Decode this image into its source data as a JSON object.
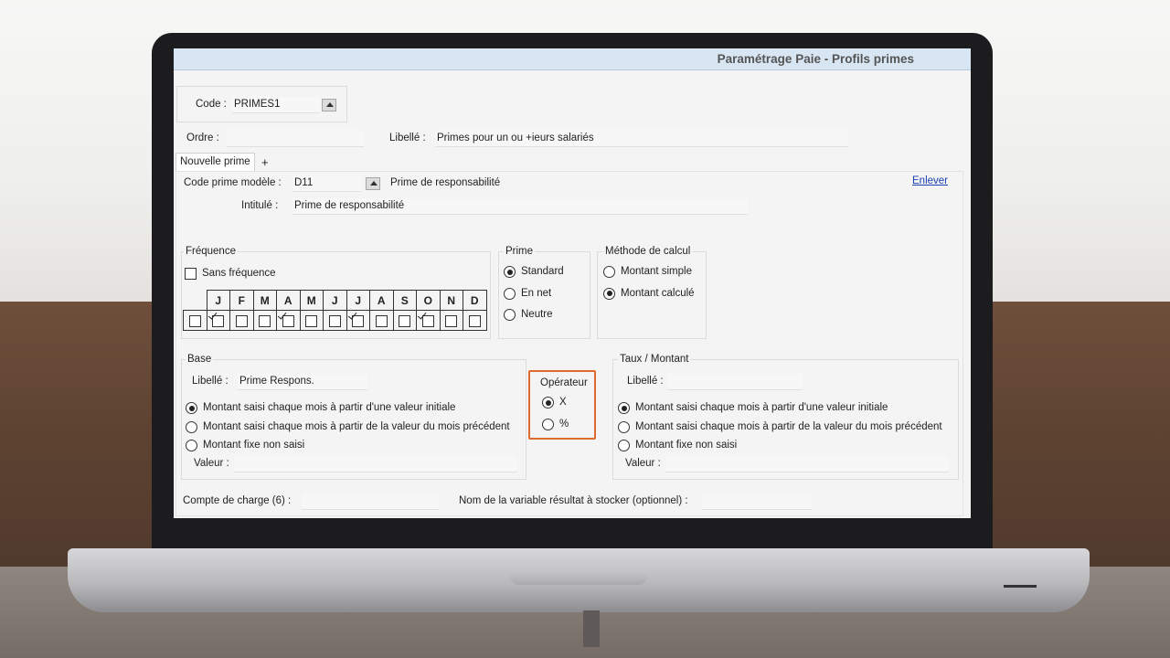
{
  "window": {
    "title": "Paramétrage Paie - Profils primes"
  },
  "header": {
    "code_label": "Code :",
    "code_value": "PRIMES1",
    "ordre_label": "Ordre :",
    "ordre_value": "",
    "libelle_label": "Libellé :",
    "libelle_value": "Primes pour un ou +ieurs salariés"
  },
  "tabs": [
    {
      "label": "Nouvelle prime"
    },
    {
      "label": "+"
    }
  ],
  "prime": {
    "code_label": "Code prime modèle :",
    "code_value": "D11",
    "code_desc": "Prime de responsabilité",
    "remove_link": "Enlever",
    "intitule_label": "Intitulé :",
    "intitule_value": "Prime de responsabilité"
  },
  "frequence": {
    "title": "Fréquence",
    "sans_label": "Sans fréquence",
    "sans_checked": false,
    "months": [
      {
        "label": "J",
        "checked": true
      },
      {
        "label": "F",
        "checked": false
      },
      {
        "label": "M",
        "checked": false
      },
      {
        "label": "A",
        "checked": true
      },
      {
        "label": "M",
        "checked": false
      },
      {
        "label": "J",
        "checked": false
      },
      {
        "label": "J",
        "checked": true
      },
      {
        "label": "A",
        "checked": false
      },
      {
        "label": "S",
        "checked": false
      },
      {
        "label": "O",
        "checked": true
      },
      {
        "label": "N",
        "checked": false
      },
      {
        "label": "D",
        "checked": false
      }
    ]
  },
  "prime_type": {
    "title": "Prime",
    "options": [
      {
        "label": "Standard",
        "selected": true
      },
      {
        "label": "En net",
        "selected": false
      },
      {
        "label": "Neutre",
        "selected": false
      }
    ]
  },
  "methode": {
    "title": "Méthode de calcul",
    "options": [
      {
        "label": "Montant simple",
        "selected": false
      },
      {
        "label": "Montant calculé",
        "selected": true
      }
    ]
  },
  "base": {
    "title": "Base",
    "libelle_label": "Libellé :",
    "libelle_value": "Prime Respons.",
    "options": [
      {
        "label": "Montant saisi chaque mois à partir d'une valeur initiale",
        "selected": true
      },
      {
        "label": "Montant saisi chaque mois à partir de la valeur du mois précédent",
        "selected": false
      },
      {
        "label": "Montant fixe non saisi",
        "selected": false
      }
    ],
    "valeur_label": "Valeur :",
    "valeur_value": ""
  },
  "operateur": {
    "title": "Opérateur",
    "options": [
      {
        "label": "X",
        "selected": true
      },
      {
        "label": "%",
        "selected": false
      }
    ]
  },
  "taux": {
    "title": "Taux / Montant",
    "libelle_label": "Libellé :",
    "libelle_value": "",
    "options": [
      {
        "label": "Montant saisi chaque mois à partir d'une valeur initiale",
        "selected": true
      },
      {
        "label": "Montant saisi chaque mois à partir de la valeur du mois précédent",
        "selected": false
      },
      {
        "label": "Montant fixe non saisi",
        "selected": false
      }
    ],
    "valeur_label": "Valeur :",
    "valeur_value": ""
  },
  "footer": {
    "compte_label": "Compte de charge (6) :",
    "compte_value": "",
    "variable_label": "Nom de la variable résultat à stocker (optionnel) :",
    "variable_value": ""
  },
  "colors": {
    "highlight": "#e06a2e",
    "titlebar": "#d8e6f3",
    "link": "#1a3fb4"
  }
}
